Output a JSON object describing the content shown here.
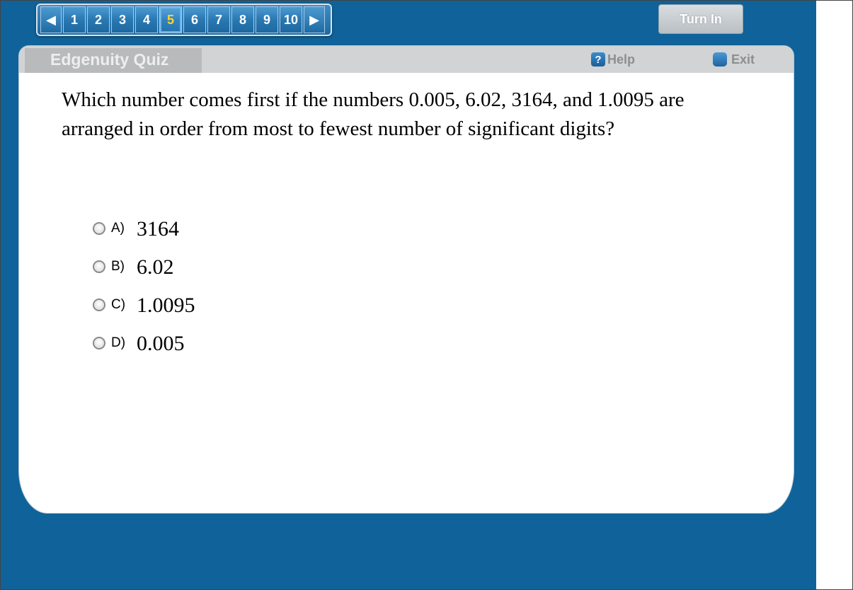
{
  "nav": {
    "prev_icon": "◀",
    "next_icon": "▶",
    "questions": [
      "1",
      "2",
      "3",
      "4",
      "5",
      "6",
      "7",
      "8",
      "9",
      "10"
    ],
    "current": "5"
  },
  "toolbar": {
    "turn_in_label": "Turn In"
  },
  "panel": {
    "title": "Edgenuity Quiz",
    "help_icon": "?",
    "help_label": "Help",
    "exit_label": "Exit"
  },
  "question": {
    "text": "Which number comes first if the numbers 0.005, 6.02, 3164, and 1.0095 are arranged in order from most to fewest number of significant digits?"
  },
  "choices": [
    {
      "letter": "A)",
      "text": "3164"
    },
    {
      "letter": "B)",
      "text": "6.02"
    },
    {
      "letter": "C)",
      "text": "1.0095"
    },
    {
      "letter": "D)",
      "text": "0.005"
    }
  ],
  "colors": {
    "background": "#0f639a",
    "current_question": "#ffd42a"
  }
}
